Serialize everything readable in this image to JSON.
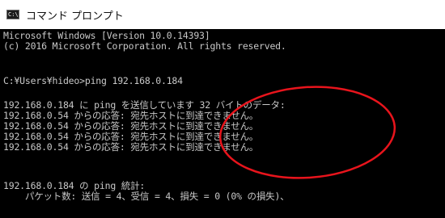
{
  "window": {
    "title": "コマンド プロンプト",
    "icon_label": "C:\\"
  },
  "console": {
    "lines": [
      "Microsoft Windows [Version 10.0.14393]",
      "(c) 2016 Microsoft Corporation. All rights reserved.",
      "",
      "C:¥Users¥hideo>ping 192.168.0.184",
      "",
      "192.168.0.184 に ping を送信しています 32 バイトのデータ:",
      "192.168.0.54 からの応答: 宛先ホストに到達できません。",
      "192.168.0.54 からの応答: 宛先ホストに到達できません。",
      "192.168.0.54 からの応答: 宛先ホストに到達できません。",
      "192.168.0.54 からの応答: 宛先ホストに到達できません。",
      "",
      "192.168.0.184 の ping 統計:",
      "    パケット数: 送信 = 4、受信 = 4、損失 = 0 (0% の損失)、"
    ]
  },
  "colors": {
    "console_bg": "#000000",
    "console_text": "#c8c8c8",
    "annotation": "#e8141c"
  }
}
